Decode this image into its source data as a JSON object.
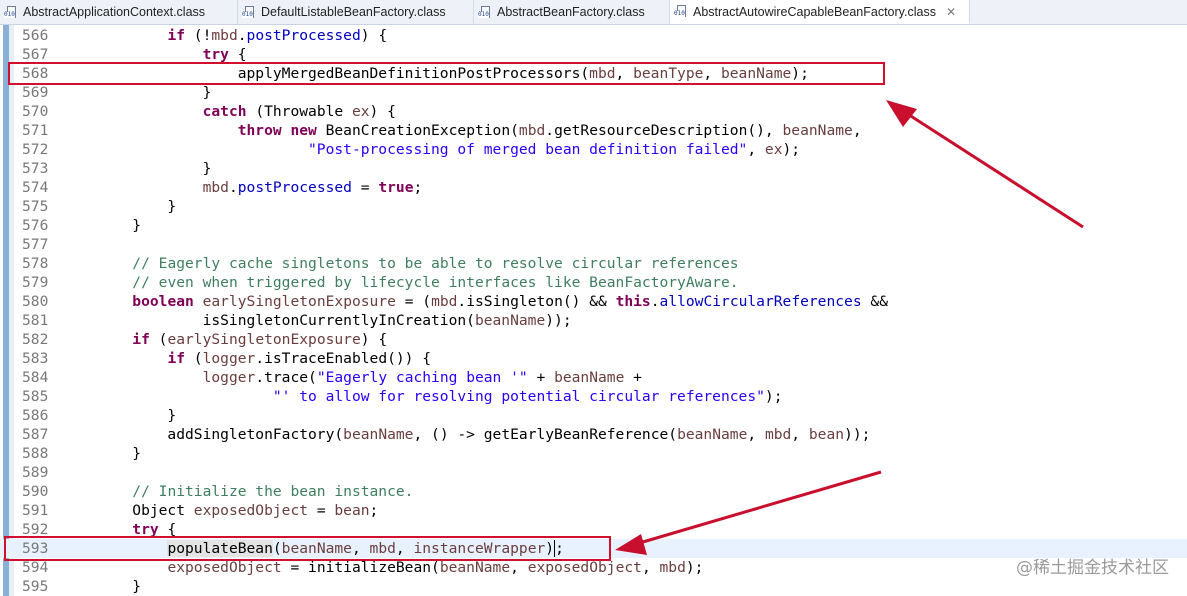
{
  "tabs": [
    {
      "label": "AbstractApplicationContext.class",
      "active": false
    },
    {
      "label": "DefaultListableBeanFactory.class",
      "active": false
    },
    {
      "label": "AbstractBeanFactory.class",
      "active": false
    },
    {
      "label": "AbstractAutowireCapableBeanFactory.class",
      "active": true
    }
  ],
  "tab_icon_bits": "010",
  "close_glyph": "✕",
  "lines": [
    {
      "num": "566",
      "text": "            if (!mbd.postProcessed) {"
    },
    {
      "num": "567",
      "text": "                try {"
    },
    {
      "num": "568",
      "text": "                    applyMergedBeanDefinitionPostProcessors(mbd, beanType, beanName);"
    },
    {
      "num": "569",
      "text": "                }"
    },
    {
      "num": "570",
      "text": "                catch (Throwable ex) {"
    },
    {
      "num": "571",
      "text": "                    throw new BeanCreationException(mbd.getResourceDescription(), beanName,"
    },
    {
      "num": "572",
      "text": "                            \"Post-processing of merged bean definition failed\", ex);"
    },
    {
      "num": "573",
      "text": "                }"
    },
    {
      "num": "574",
      "text": "                mbd.postProcessed = true;"
    },
    {
      "num": "575",
      "text": "            }"
    },
    {
      "num": "576",
      "text": "        }"
    },
    {
      "num": "577",
      "text": ""
    },
    {
      "num": "578",
      "text": "        // Eagerly cache singletons to be able to resolve circular references"
    },
    {
      "num": "579",
      "text": "        // even when triggered by lifecycle interfaces like BeanFactoryAware."
    },
    {
      "num": "580",
      "text": "        boolean earlySingletonExposure = (mbd.isSingleton() && this.allowCircularReferences &&"
    },
    {
      "num": "581",
      "text": "                isSingletonCurrentlyInCreation(beanName));"
    },
    {
      "num": "582",
      "text": "        if (earlySingletonExposure) {"
    },
    {
      "num": "583",
      "text": "            if (logger.isTraceEnabled()) {"
    },
    {
      "num": "584",
      "text": "                logger.trace(\"Eagerly caching bean '\" + beanName +"
    },
    {
      "num": "585",
      "text": "                        \"' to allow for resolving potential circular references\");"
    },
    {
      "num": "586",
      "text": "            }"
    },
    {
      "num": "587",
      "text": "            addSingletonFactory(beanName, () -> getEarlyBeanReference(beanName, mbd, bean));"
    },
    {
      "num": "588",
      "text": "        }"
    },
    {
      "num": "589",
      "text": ""
    },
    {
      "num": "590",
      "text": "        // Initialize the bean instance."
    },
    {
      "num": "591",
      "text": "        Object exposedObject = bean;"
    },
    {
      "num": "592",
      "text": "        try {"
    },
    {
      "num": "593",
      "text": "            populateBean(beanName, mbd, instanceWrapper);"
    },
    {
      "num": "594",
      "text": "            exposedObject = initializeBean(beanName, exposedObject, mbd);"
    },
    {
      "num": "595",
      "text": "        }"
    }
  ],
  "watermark": "@稀土掘金技术社区",
  "colors": {
    "annotation": "#d0102e",
    "keyword": "#7f0055",
    "field": "#0000c0",
    "string": "#2a00ff",
    "comment": "#3f7f5f",
    "variable": "#6a3e3e",
    "current_line": "#e8f2fe"
  }
}
